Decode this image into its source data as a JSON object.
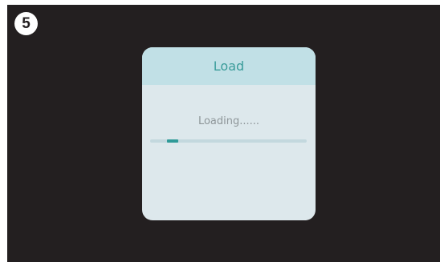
{
  "step_badge": {
    "number": "5"
  },
  "dialog": {
    "title": "Load",
    "status_text": "Loading......",
    "progress": {
      "fill_start_fraction": 0.11,
      "fill_end_fraction": 0.18
    }
  },
  "colors": {
    "screen_background": "#231f20",
    "dialog_body": "#dde8ec",
    "dialog_header": "#c1e0e6",
    "accent": "#2f9a98",
    "status_text": "#8e9699"
  },
  "icons": {
    "step_badge": "step-number-badge"
  }
}
